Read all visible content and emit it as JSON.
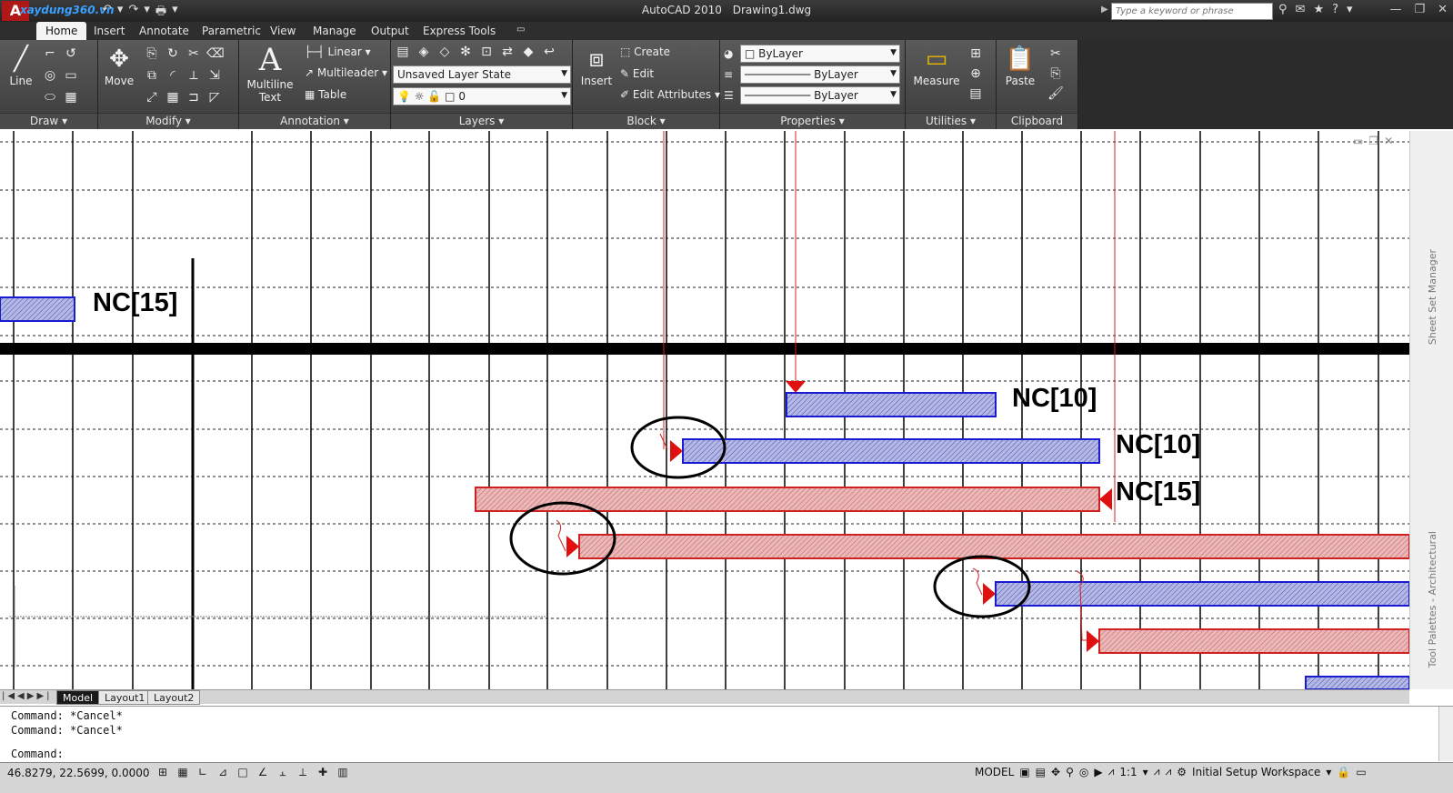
{
  "window": {
    "app_name": "AutoCAD 2010",
    "file_name": "Drawing1.dwg",
    "watermark": "xaydung360.vn",
    "search_placeholder": "Type a keyword or phrase"
  },
  "ribbon_tabs": [
    "Home",
    "Insert",
    "Annotate",
    "Parametric",
    "View",
    "Manage",
    "Output",
    "Express Tools"
  ],
  "panels": {
    "draw": {
      "label": "Draw",
      "line": "Line"
    },
    "modify": {
      "label": "Modify",
      "move": "Move"
    },
    "annotation": {
      "label": "Annotation",
      "multiline_text": "Multiline Text",
      "linear": "Linear",
      "multileader": "Multileader",
      "table": "Table"
    },
    "layers": {
      "label": "Layers",
      "layer_state": "Unsaved Layer State",
      "current_layer": "0"
    },
    "block": {
      "label": "Block",
      "insert": "Insert",
      "create": "Create",
      "edit": "Edit",
      "edit_attributes": "Edit Attributes"
    },
    "properties": {
      "label": "Properties",
      "color": "ByLayer",
      "linetype": "ByLayer",
      "lineweight": "ByLayer"
    },
    "utilities": {
      "label": "Utilities",
      "measure": "Measure"
    },
    "clipboard": {
      "label": "Clipboard",
      "paste": "Paste"
    }
  },
  "drawing": {
    "labels": [
      {
        "text": "NC[15]"
      },
      {
        "text": "NC[10]"
      },
      {
        "text": "NC[10]"
      },
      {
        "text": "NC[15]"
      }
    ],
    "colors": {
      "blue_bar": "#9da3d6",
      "blue_edge": "#1a1ad0",
      "red_bar": "#dca0a0",
      "red_edge": "#d02020",
      "marker": "#e01010"
    }
  },
  "palettes": {
    "sheet_set": "Sheet Set Manager",
    "tool_palettes": "Tool Palettes - Architectural"
  },
  "layout_tabs": [
    "Model",
    "Layout1",
    "Layout2"
  ],
  "command_history": [
    "Command: *Cancel*",
    "Command: *Cancel*"
  ],
  "command_prompt": "Command:",
  "status": {
    "coordinates": "46.8279, 22.5699, 0.0000",
    "space": "MODEL",
    "annotation_scale": "1:1",
    "workspace": "Initial Setup Workspace"
  }
}
